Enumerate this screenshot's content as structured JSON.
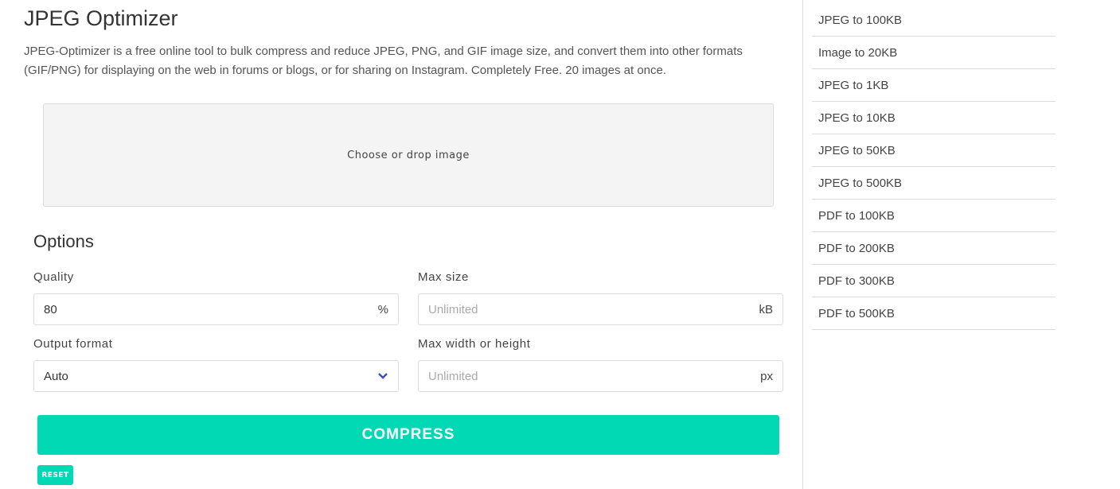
{
  "title": "JPEG Optimizer",
  "description": "JPEG-Optimizer is a free online tool to bulk compress and reduce JPEG, PNG, and GIF image size, and convert them into other formats (GIF/PNG) for displaying on the web in forums or blogs, or for sharing on Instagram. Completely Free. 20 images at once.",
  "dropzone": {
    "label": "Choose or drop image"
  },
  "options": {
    "heading": "Options",
    "quality": {
      "label": "Quality",
      "value": "80",
      "unit": "%"
    },
    "max_size": {
      "label": "Max size",
      "placeholder": "Unlimited",
      "unit": "kB"
    },
    "output_format": {
      "label": "Output format",
      "value": "Auto",
      "icon": "chevron-down-icon"
    },
    "max_dim": {
      "label": "Max width or height",
      "placeholder": "Unlimited",
      "unit": "px"
    }
  },
  "buttons": {
    "compress": "COMPRESS",
    "reset": "RESET"
  },
  "colors": {
    "accent": "#00d9b4",
    "chevron": "#3f51b5"
  },
  "sidebar": {
    "items": [
      {
        "label": "JPEG to 100KB"
      },
      {
        "label": "Image to 20KB"
      },
      {
        "label": "JPEG to 1KB"
      },
      {
        "label": "JPEG to 10KB"
      },
      {
        "label": "JPEG to 50KB"
      },
      {
        "label": "JPEG to 500KB"
      },
      {
        "label": "PDF to 100KB"
      },
      {
        "label": "PDF to 200KB"
      },
      {
        "label": "PDF to 300KB"
      },
      {
        "label": "PDF to 500KB"
      }
    ]
  }
}
